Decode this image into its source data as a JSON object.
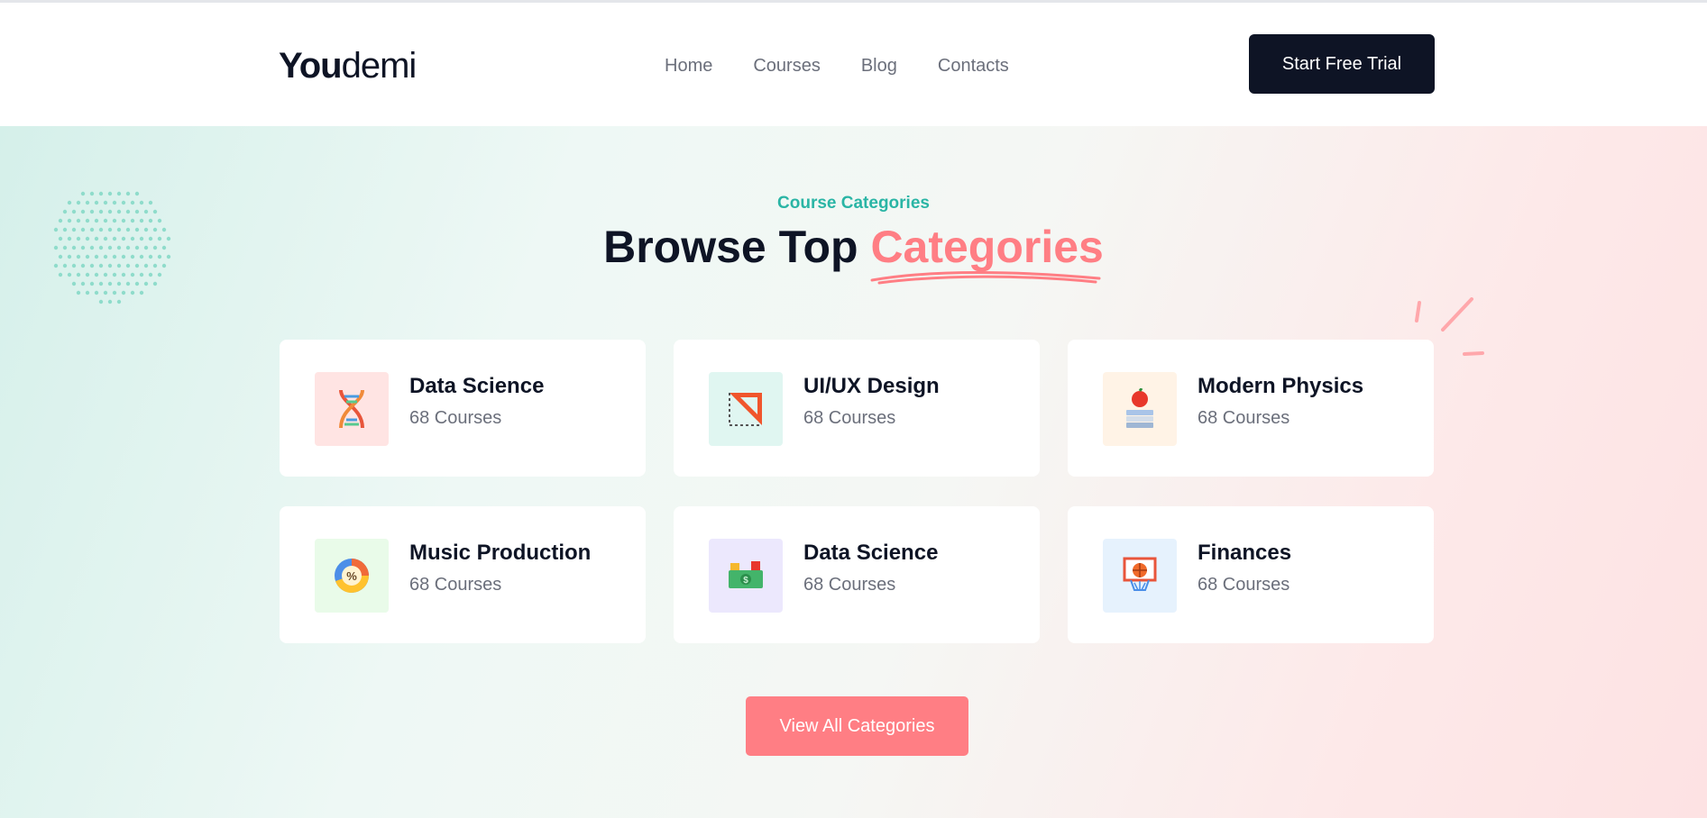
{
  "brand": {
    "logo_bold": "You",
    "logo_light": "demi"
  },
  "nav": {
    "items": [
      "Home",
      "Courses",
      "Blog",
      "Contacts"
    ]
  },
  "header": {
    "cta_label": "Start Free Trial"
  },
  "section": {
    "eyebrow": "Course Categories",
    "title_prefix": "Browse Top ",
    "title_highlight": "Categories"
  },
  "categories": [
    {
      "name": "Data Science",
      "count": "68 Courses",
      "icon": "dna-icon",
      "tint": "#ffe4e3"
    },
    {
      "name": "UI/UX Design",
      "count": "68 Courses",
      "icon": "set-square-icon",
      "tint": "#e0f6f1"
    },
    {
      "name": "Modern Physics",
      "count": "68 Courses",
      "icon": "apple-books-icon",
      "tint": "#fff3e6"
    },
    {
      "name": "Music Production",
      "count": "68 Courses",
      "icon": "percent-chart-icon",
      "tint": "#e9fbe9"
    },
    {
      "name": "Data Science",
      "count": "68 Courses",
      "icon": "money-icon",
      "tint": "#ece8fd"
    },
    {
      "name": "Finances",
      "count": "68 Courses",
      "icon": "basketball-hoop-icon",
      "tint": "#e6f2fd"
    }
  ],
  "footer_cta": {
    "label": "View All Categories"
  },
  "colors": {
    "accent": "#ff7e84",
    "teal": "#2ab5a5",
    "dark": "#0e1425",
    "muted": "#6b6f7b"
  }
}
